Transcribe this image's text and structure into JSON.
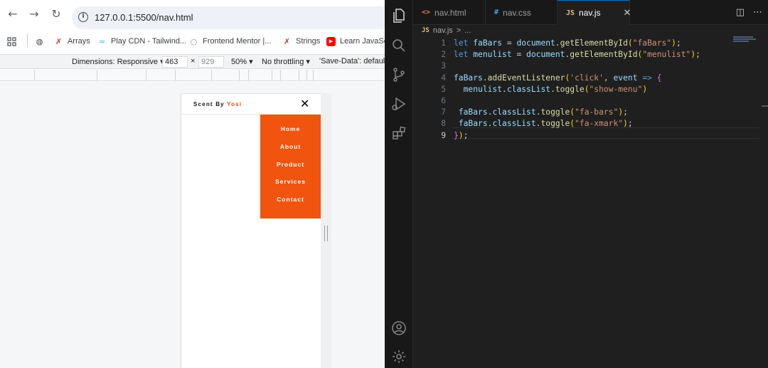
{
  "browser": {
    "url": "127.0.0.1:5500/nav.html",
    "bookmarks": [
      {
        "icon": "grid-icon",
        "label": ""
      },
      {
        "icon": "globe-icon",
        "label": ""
      },
      {
        "icon": "arrays-icon",
        "label": "Arrays"
      },
      {
        "icon": "tailwind-icon",
        "label": "Play CDN - Tailwind..."
      },
      {
        "icon": "frontend-mentor-icon",
        "label": "Frontend Mentor |..."
      },
      {
        "icon": "strings-icon",
        "label": "Strings"
      },
      {
        "icon": "youtube-icon",
        "label": "Learn JavaScri"
      }
    ],
    "devtools": {
      "dimensions_label": "Dimensions: Responsive ▾",
      "width": "463",
      "times": "×",
      "height": "929",
      "zoom": "50% ▾",
      "throttle": "No throttling ▾",
      "save_data": "'Save-Data': default"
    },
    "page": {
      "brand_text": "Scent By ",
      "brand_accent": "Yosi",
      "close_glyph": "✕",
      "menu_items": [
        "Home",
        "About",
        "Product",
        "Services",
        "Contact"
      ],
      "accent_color": "#f0540e"
    }
  },
  "editor": {
    "tabs": [
      {
        "icon": "<>",
        "label": "nav.html",
        "active": false
      },
      {
        "icon": "#",
        "label": "nav.css",
        "active": false
      },
      {
        "icon": "JS",
        "label": "nav.js",
        "active": true
      }
    ],
    "tab_close": "✕",
    "breadcrumb": {
      "icon": "JS",
      "file": "nav.js",
      "sep": ">",
      "rest": "..."
    },
    "current_line": 9,
    "lines": [
      {
        "n": "1",
        "tokens": [
          [
            "k",
            "let "
          ],
          [
            "v",
            "faBars"
          ],
          [
            "p",
            " = "
          ],
          [
            "v",
            "document"
          ],
          [
            "p",
            "."
          ],
          [
            "f",
            "getElementById"
          ],
          [
            "b1",
            "("
          ],
          [
            "s",
            "\"faBars\""
          ],
          [
            "b1",
            ")"
          ],
          [
            "p",
            ";"
          ]
        ]
      },
      {
        "n": "2",
        "tokens": [
          [
            "k",
            "let "
          ],
          [
            "v",
            "menulist"
          ],
          [
            "p",
            " = "
          ],
          [
            "v",
            "document"
          ],
          [
            "p",
            "."
          ],
          [
            "f",
            "getElementById"
          ],
          [
            "b1",
            "("
          ],
          [
            "s",
            "\"menulist\""
          ],
          [
            "b1",
            ")"
          ],
          [
            "p",
            ";"
          ]
        ]
      },
      {
        "n": "3",
        "tokens": []
      },
      {
        "n": "4",
        "tokens": [
          [
            "v",
            "faBars"
          ],
          [
            "p",
            "."
          ],
          [
            "f",
            "addEventListener"
          ],
          [
            "b1",
            "("
          ],
          [
            "s",
            "'click'"
          ],
          [
            "p",
            ", "
          ],
          [
            "v",
            "event"
          ],
          [
            "p",
            " "
          ],
          [
            "k",
            "=>"
          ],
          [
            "p",
            " "
          ],
          [
            "b2",
            "{"
          ]
        ]
      },
      {
        "n": "5",
        "tokens": [
          [
            "p",
            "  "
          ],
          [
            "v",
            "menulist"
          ],
          [
            "p",
            "."
          ],
          [
            "v",
            "classList"
          ],
          [
            "p",
            "."
          ],
          [
            "f",
            "toggle"
          ],
          [
            "b1",
            "("
          ],
          [
            "s",
            "\"show-menu\""
          ],
          [
            "b1",
            ")"
          ]
        ]
      },
      {
        "n": "6",
        "tokens": []
      },
      {
        "n": "7",
        "tokens": [
          [
            "p",
            " "
          ],
          [
            "v",
            "faBars"
          ],
          [
            "p",
            "."
          ],
          [
            "v",
            "classList"
          ],
          [
            "p",
            "."
          ],
          [
            "f",
            "toggle"
          ],
          [
            "b1",
            "("
          ],
          [
            "s",
            "\"fa-bars\""
          ],
          [
            "b1",
            ")"
          ],
          [
            "p",
            ";"
          ]
        ]
      },
      {
        "n": "8",
        "tokens": [
          [
            "p",
            " "
          ],
          [
            "v",
            "faBars"
          ],
          [
            "p",
            "."
          ],
          [
            "v",
            "classList"
          ],
          [
            "p",
            "."
          ],
          [
            "f",
            "toggle"
          ],
          [
            "b1",
            "("
          ],
          [
            "s",
            "\"fa-xmark\""
          ],
          [
            "b1",
            ")"
          ],
          [
            "p",
            ";"
          ]
        ]
      },
      {
        "n": "9",
        "tokens": [
          [
            "b2",
            "}"
          ],
          [
            "b1",
            ")"
          ],
          [
            "p",
            ";"
          ]
        ]
      }
    ]
  }
}
